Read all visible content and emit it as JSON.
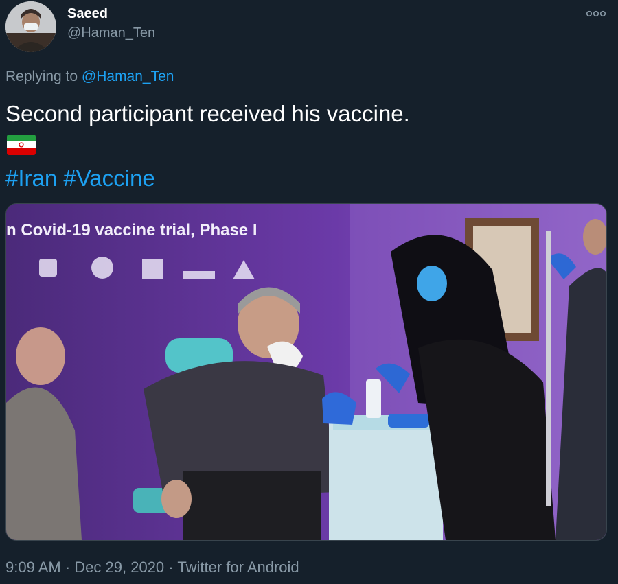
{
  "author": {
    "display_name": "Saeed",
    "handle": "@Haman_Ten"
  },
  "reply": {
    "prefix": "Replying to",
    "mention": "@Haman_Ten"
  },
  "tweet": {
    "text": "Second participant received his vaccine.",
    "flag_emoji": "flag-iran-icon",
    "hashtags": [
      "#Iran",
      "#Vaccine"
    ]
  },
  "media": {
    "banner_text": "n Covid-19 vaccine trial, Phase I"
  },
  "meta": {
    "time": "9:09 AM",
    "separator": "·",
    "date": "Dec 29, 2020",
    "source": "Twitter for Android"
  },
  "icons": {
    "more": "more-options-icon"
  },
  "colors": {
    "background": "#15202b",
    "accent": "#1da1f2",
    "secondary_text": "#8899a6"
  }
}
